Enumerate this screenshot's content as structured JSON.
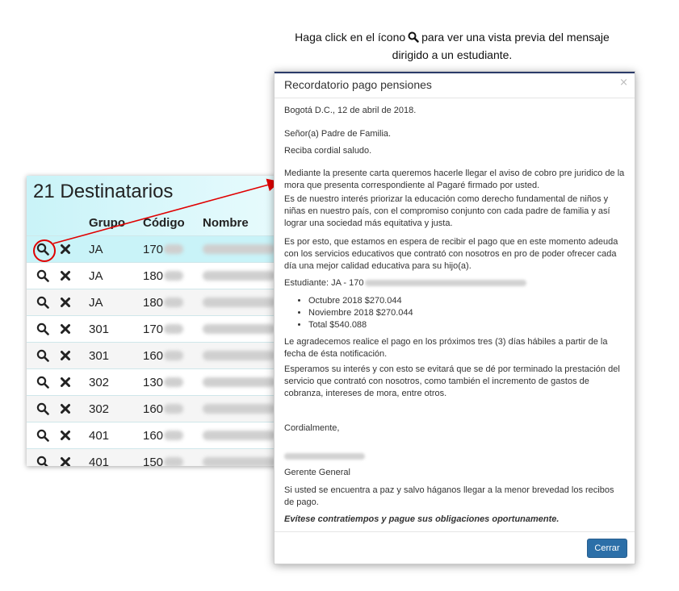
{
  "caption": {
    "line1_before": "Haga click en el ícono",
    "line1_after": "para ver una vista previa del mensaje",
    "line2": "dirigido a un estudiante."
  },
  "panel": {
    "title": "21 Destinatarios",
    "columns": {
      "grupo": "Grupo",
      "codigo": "Código",
      "nombre": "Nombre"
    },
    "rows": [
      {
        "grupo": "JA",
        "codigo": "170"
      },
      {
        "grupo": "JA",
        "codigo": "180"
      },
      {
        "grupo": "JA",
        "codigo": "180"
      },
      {
        "grupo": "301",
        "codigo": "170"
      },
      {
        "grupo": "301",
        "codigo": "160"
      },
      {
        "grupo": "302",
        "codigo": "130"
      },
      {
        "grupo": "302",
        "codigo": "160"
      },
      {
        "grupo": "401",
        "codigo": "160"
      },
      {
        "grupo": "401",
        "codigo": "150"
      }
    ]
  },
  "modal": {
    "title": "Recordatorio pago pensiones",
    "close_symbol": "×",
    "date": "Bogotá D.C., 12 de abril de 2018.",
    "salutation": "Señor(a) Padre de Familia.",
    "greeting": "Reciba cordial saludo.",
    "p1": "Mediante la presente carta queremos hacerle llegar el aviso de cobro pre juridico de la mora que presenta correspondiente al Pagaré firmado por usted.",
    "p2": "Es de nuestro interés priorizar la educación como derecho fundamental de niños y niñas en nuestro país, con el compromiso conjunto con cada padre de familia y así lograr una sociedad más equitativa y justa.",
    "p3": "Es por esto, que estamos en espera de recibir el pago que en este momento adeuda con los servicios educativos que contrató con nosotros en pro de poder ofrecer cada día una mejor calidad educativa para su hijo(a).",
    "student_label": "Estudiante: JA - 170",
    "items": [
      "Octubre 2018 $270.044",
      "Noviembre 2018 $270.044",
      "Total $540.088"
    ],
    "p4": "Le agradecemos realice el pago en los próximos tres (3) días hábiles a partir de la fecha de ésta notificación.",
    "p5": "Esperamos su interés y con esto se evitará que se dé por terminado la prestación del servicio que contrató con nosotros, como también el incremento de gastos de cobranza, intereses de mora, entre otros.",
    "closing": "Cordialmente,",
    "role": "Gerente General",
    "p6": "Si usted se encuentra a paz y salvo háganos llegar a la menor brevedad los recibos de pago.",
    "motto": "Evítese contratiempos y pague sus obligaciones oportunamente.",
    "close_button": "Cerrar"
  },
  "colors": {
    "accent": "#2c6fa8",
    "highlight": "#e00000",
    "panel_bg": "#c9f3f8"
  }
}
